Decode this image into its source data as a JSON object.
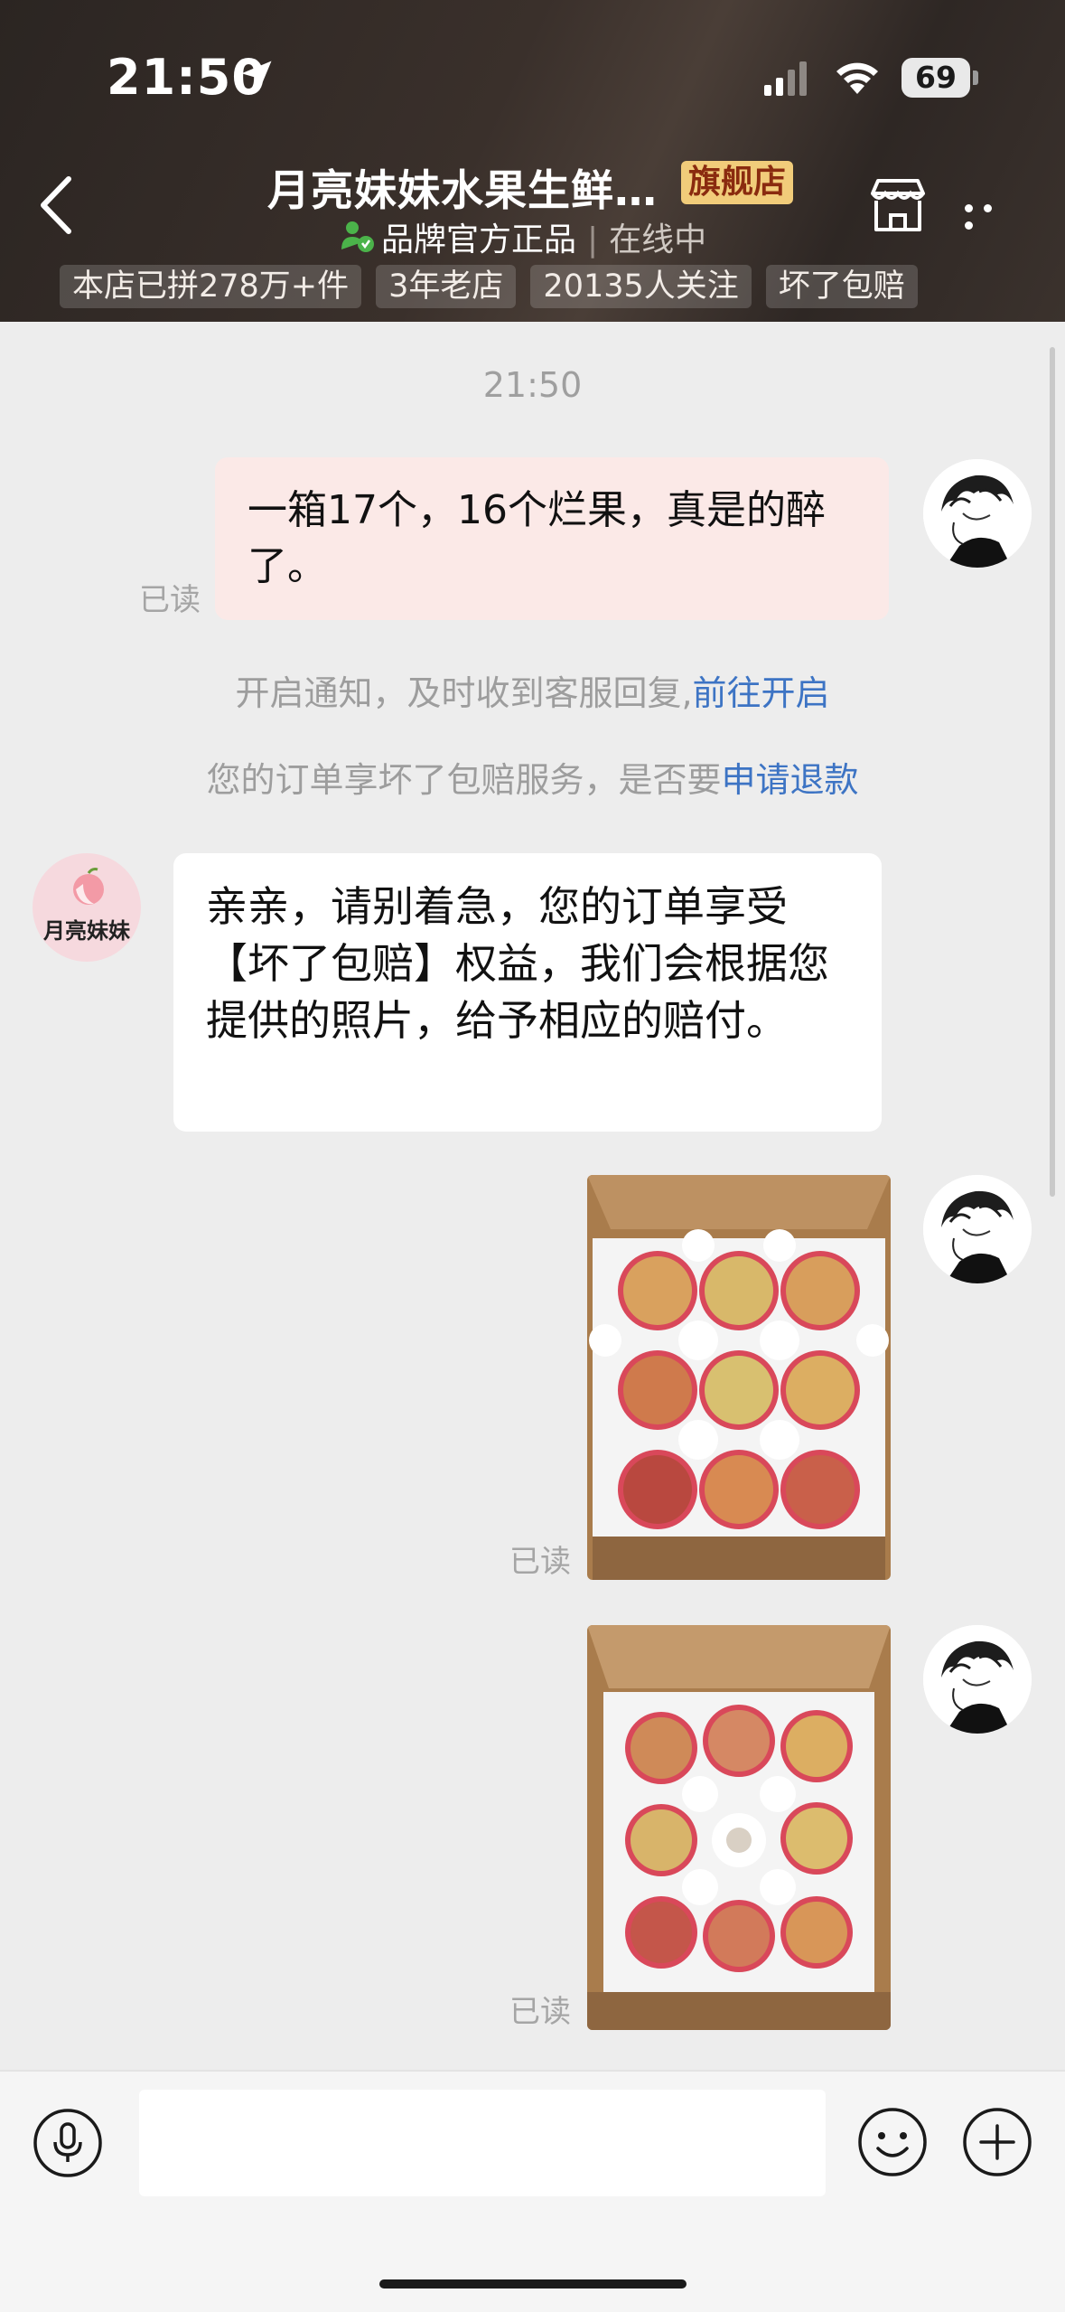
{
  "status_bar": {
    "time": "21:50",
    "battery": "69"
  },
  "header": {
    "shop_name": "月亮妹妹水果生鲜…",
    "shop_badge": "旗舰店",
    "brand_official": "品牌官方正品",
    "separator": "|",
    "online_status": "在线中",
    "tags": [
      "本店已拼278万+件",
      "3年老店",
      "20135人关注",
      "坏了包赔"
    ]
  },
  "chat": {
    "timestamp": "21:50",
    "messages": [
      {
        "sender": "user",
        "text": "一箱17个，16个烂果，真是的醉了。",
        "read_status": "已读"
      },
      {
        "sender": "system",
        "text": "开启通知，及时收到客服回复,",
        "link": "前往开启"
      },
      {
        "sender": "system",
        "text": "您的订单享坏了包赔服务，是否要",
        "link": "申请退款"
      },
      {
        "sender": "shop",
        "avatar_text": "月亮妹妹",
        "text": "亲亲，请别着急，您的订单享受【坏了包赔】权益，我们会根据您提供的照片，给予相应的赔付。"
      },
      {
        "sender": "user",
        "type": "image",
        "read_status": "已读"
      },
      {
        "sender": "user",
        "type": "image",
        "read_status": "已读"
      }
    ]
  },
  "input": {
    "placeholder": ""
  },
  "colors": {
    "header_bg": "#2e2724",
    "badge_bg": "#f1cc7a",
    "link": "#3d74c4",
    "outgoing_bubble": "#fbe9e7",
    "chat_bg": "#ededed"
  },
  "icons": [
    "location-arrow-icon",
    "signal-icon",
    "wifi-icon",
    "back-chevron-icon",
    "store-icon",
    "more-icon",
    "verified-icon",
    "microphone-icon",
    "emoji-icon",
    "plus-icon"
  ]
}
